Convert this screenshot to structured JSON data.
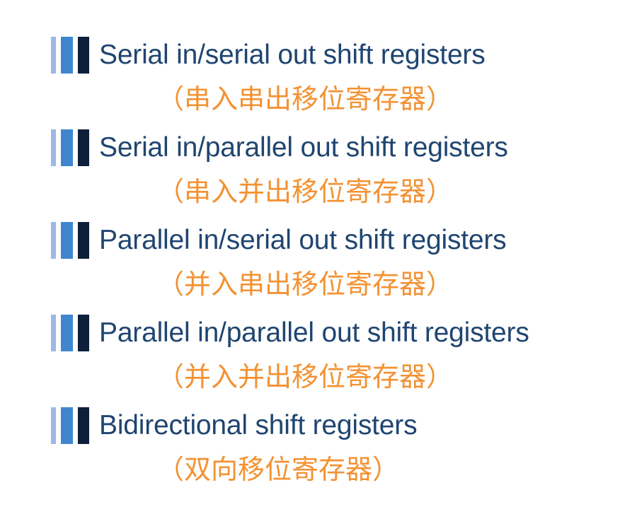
{
  "items": [
    {
      "en": "Serial in/serial out shift registers",
      "zh": "（串入串出移位寄存器）"
    },
    {
      "en": "Serial in/parallel out shift registers",
      "zh": "（串入并出移位寄存器）"
    },
    {
      "en": "Parallel in/serial out shift registers",
      "zh": "（并入串出移位寄存器）"
    },
    {
      "en": "Parallel in/parallel out shift registers",
      "zh": "（并入并出移位寄存器）"
    },
    {
      "en": "Bidirectional shift registers",
      "zh": "（双向移位寄存器）"
    }
  ],
  "colors": {
    "english_text": "#1f4570",
    "chinese_text": "#f39233",
    "bullet_light": "#9db8e6",
    "bullet_mid": "#3f86cf",
    "bullet_dark": "#0e1f3a"
  }
}
